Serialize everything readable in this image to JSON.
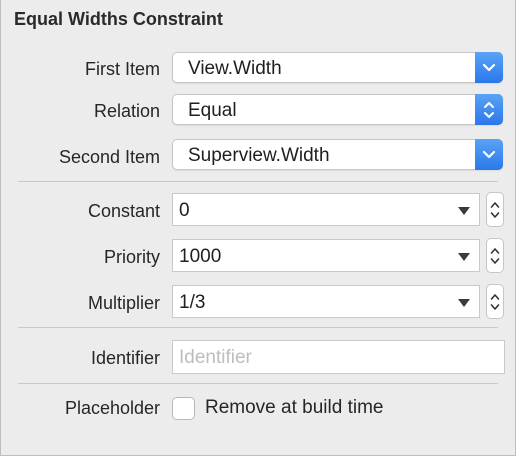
{
  "panel": {
    "title": "Equal Widths Constraint"
  },
  "first_item": {
    "label": "First Item",
    "value": "View.Width"
  },
  "relation": {
    "label": "Relation",
    "value": "Equal"
  },
  "second_item": {
    "label": "Second Item",
    "value": "Superview.Width"
  },
  "constant": {
    "label": "Constant",
    "value": "0"
  },
  "priority": {
    "label": "Priority",
    "value": "1000"
  },
  "multiplier": {
    "label": "Multiplier",
    "value": "1/3"
  },
  "identifier": {
    "label": "Identifier",
    "value": "",
    "placeholder": "Identifier"
  },
  "placeholder": {
    "label": "Placeholder",
    "checkbox_label": "Remove at build time",
    "checked": false
  },
  "colors": {
    "accent": "#2a78ea",
    "background": "#ececec",
    "separator": "#c8c8c8"
  },
  "icons": {
    "popup_arrow": "chevron-down-icon",
    "popup_stepper": "up-down-chevron-icon",
    "combo_arrow": "triangle-down-icon",
    "stepper": "stepper-icon"
  }
}
